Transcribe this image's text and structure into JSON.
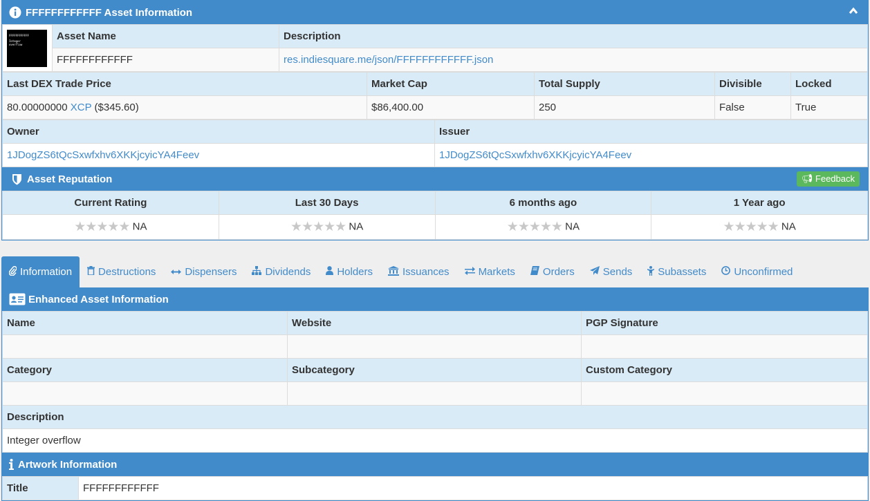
{
  "asset_panel": {
    "title": "FFFFFFFFFFFF Asset Information",
    "asset_name_label": "Asset Name",
    "asset_name": "FFFFFFFFFFFF",
    "description_label": "Description",
    "description": "res.indiesquare.me/json/FFFFFFFFFFFF.json",
    "thumbnail_lines": [
      "FFFFFFFFFFFF",
      "Integer",
      "overflow"
    ],
    "headers": [
      "Last DEX Trade Price",
      "Market Cap",
      "Total Supply",
      "Divisible",
      "Locked"
    ],
    "last_price": "80.00000000",
    "last_price_unit": "XCP",
    "last_price_usd": "($345.60)",
    "market_cap": "$86,400.00",
    "total_supply": "250",
    "divisible": "False",
    "locked": "True",
    "owner_label": "Owner",
    "owner": "1JDogZS6tQcSxwfxhv6XKKjcyicYA4Feev",
    "issuer_label": "Issuer",
    "issuer": "1JDogZS6tQcSxwfxhv6XKKjcyicYA4Feev"
  },
  "reputation": {
    "title": "Asset Reputation",
    "feedback_label": "Feedback",
    "columns": [
      "Current Rating",
      "Last 30 Days",
      "6 months ago",
      "1 Year ago"
    ],
    "values": [
      "NA",
      "NA",
      "NA",
      "NA"
    ],
    "star_count": 5
  },
  "tabs": [
    {
      "label": "Information",
      "icon": "paperclip-icon",
      "active": true
    },
    {
      "label": "Destructions",
      "icon": "trash-icon"
    },
    {
      "label": "Dispensers",
      "icon": "arrows-h-icon"
    },
    {
      "label": "Dividends",
      "icon": "sitemap-icon"
    },
    {
      "label": "Holders",
      "icon": "user-icon"
    },
    {
      "label": "Issuances",
      "icon": "bank-icon"
    },
    {
      "label": "Markets",
      "icon": "exchange-icon"
    },
    {
      "label": "Orders",
      "icon": "book-icon"
    },
    {
      "label": "Sends",
      "icon": "paper-plane-icon"
    },
    {
      "label": "Subassets",
      "icon": "child-icon"
    },
    {
      "label": "Unconfirmed",
      "icon": "clock-icon"
    }
  ],
  "enhanced": {
    "title": "Enhanced Asset Information",
    "name_label": "Name",
    "website_label": "Website",
    "pgp_label": "PGP Signature",
    "name": "",
    "website": "",
    "pgp": "",
    "category_label": "Category",
    "subcategory_label": "Subcategory",
    "custom_category_label": "Custom Category",
    "category": "",
    "subcategory": "",
    "custom_category": "",
    "description_label": "Description",
    "description": "Integer overflow"
  },
  "artwork": {
    "title": "Artwork Information",
    "title_label": "Title",
    "title_value": "FFFFFFFFFFFF"
  },
  "colors": {
    "primary": "#428bca",
    "header_row": "#d9ebf7",
    "feedback": "#5cb85c"
  }
}
